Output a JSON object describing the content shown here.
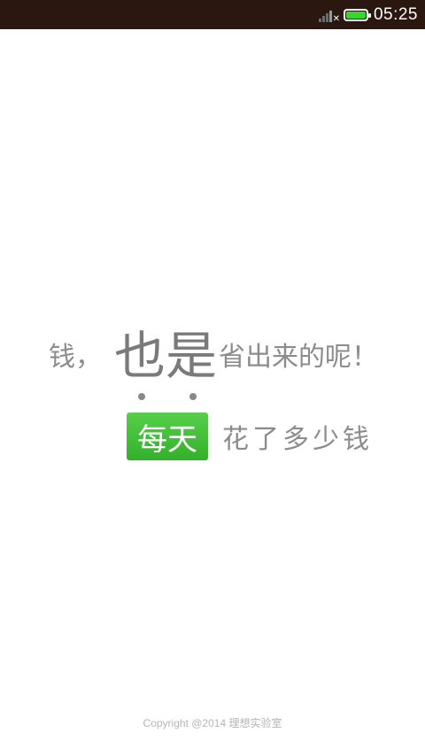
{
  "status_bar": {
    "time": "05:25",
    "icons": [
      "signal-icon",
      "battery-icon"
    ],
    "colors": {
      "background": "#2a1710",
      "battery_fill": "#39d52f"
    }
  },
  "slogan": {
    "line1_prefix": "钱，",
    "line1_emphasis": "也是",
    "line1_suffix": "省出来的呢！",
    "badge_text": "每天",
    "line2_text": "花了多少钱",
    "colors": {
      "text": "#8c8c8c",
      "badge": "#3fbd36"
    }
  },
  "footer": {
    "copyright": "Copyright @2014 理想实验室"
  }
}
